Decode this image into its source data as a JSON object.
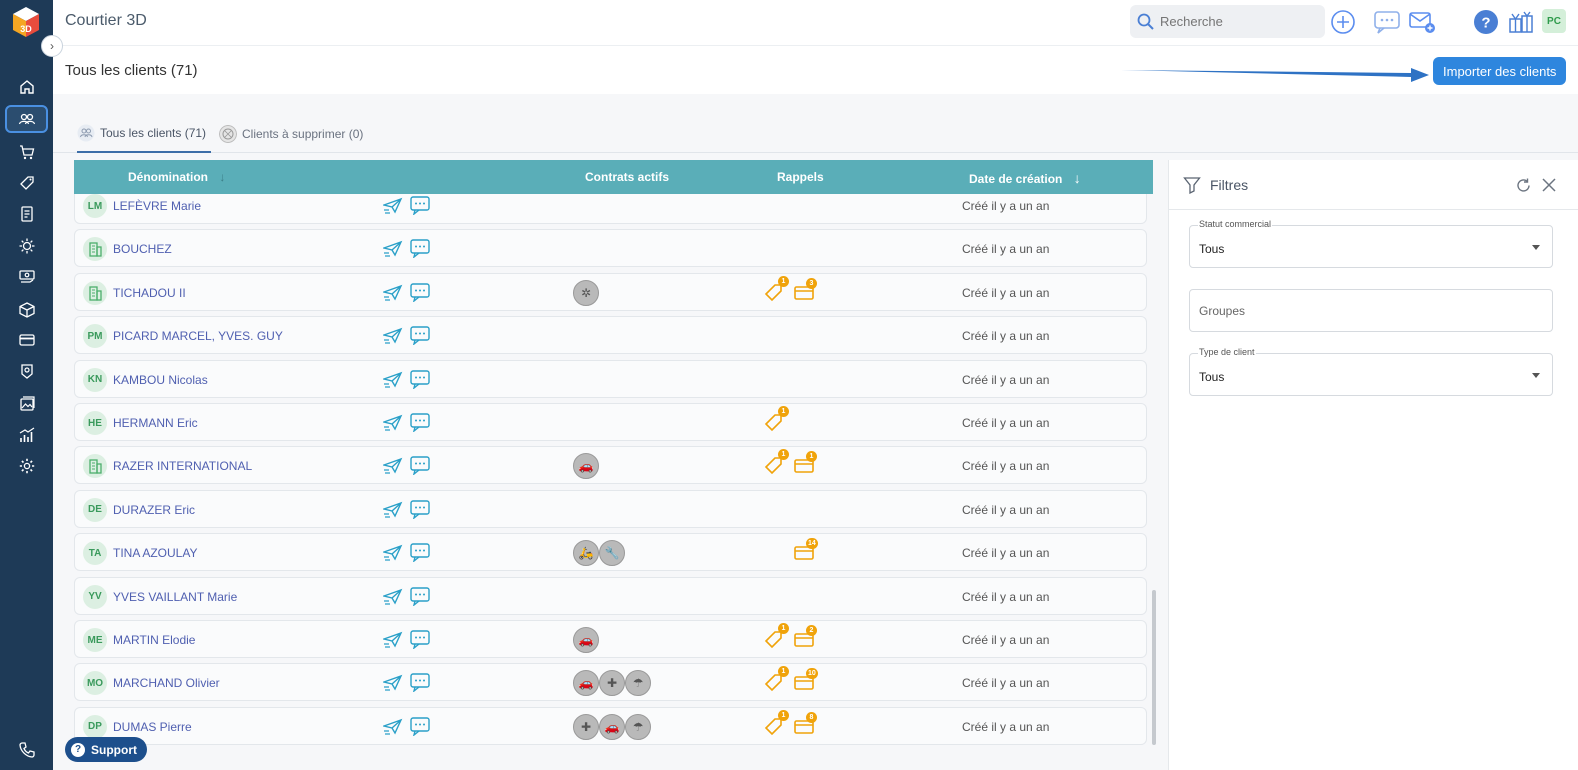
{
  "app": {
    "title": "Courtier 3D"
  },
  "search": {
    "placeholder": "Recherche"
  },
  "user": {
    "initials": "PC"
  },
  "page": {
    "title": "Tous les clients (71)",
    "import_label": "Importer des clients"
  },
  "tabs": [
    {
      "label": "Tous les clients (71)"
    },
    {
      "label": "Clients à supprimer (0)"
    }
  ],
  "table": {
    "headers": {
      "name": "Dénomination",
      "contracts": "Contrats actifs",
      "reminders": "Rappels",
      "created": "Date de création"
    }
  },
  "rows": [
    {
      "initials": "LM",
      "name": "LEFÈVRE Marie",
      "company": false,
      "contracts": [],
      "tags": null,
      "mails": null,
      "date": "Créé il y a un an"
    },
    {
      "initials": "",
      "name": "BOUCHEZ",
      "company": true,
      "contracts": [],
      "tags": null,
      "mails": null,
      "date": "Créé il y a un an"
    },
    {
      "initials": "",
      "name": "TICHADOU II",
      "company": true,
      "contracts": [
        "✲"
      ],
      "tags": "1",
      "mails": "3",
      "date": "Créé il y a un an"
    },
    {
      "initials": "PM",
      "name": "PICARD MARCEL, YVES. GUY",
      "company": false,
      "contracts": [],
      "tags": null,
      "mails": null,
      "date": "Créé il y a un an"
    },
    {
      "initials": "KN",
      "name": "KAMBOU Nicolas",
      "company": false,
      "contracts": [],
      "tags": null,
      "mails": null,
      "date": "Créé il y a un an"
    },
    {
      "initials": "HE",
      "name": "HERMANN Eric",
      "company": false,
      "contracts": [],
      "tags": "1",
      "mails": null,
      "date": "Créé il y a un an"
    },
    {
      "initials": "",
      "name": "RAZER INTERNATIONAL",
      "company": true,
      "contracts": [
        "🚗"
      ],
      "tags": "1",
      "mails": "1",
      "date": "Créé il y a un an"
    },
    {
      "initials": "DE",
      "name": "DURAZER Eric",
      "company": false,
      "contracts": [],
      "tags": null,
      "mails": null,
      "date": "Créé il y a un an"
    },
    {
      "initials": "TA",
      "name": "TINA AZOULAY",
      "company": false,
      "contracts": [
        "🛵",
        "🔧"
      ],
      "tags": null,
      "mails": "14",
      "date": "Créé il y a un an"
    },
    {
      "initials": "YV",
      "name": "YVES VAILLANT Marie",
      "company": false,
      "contracts": [],
      "tags": null,
      "mails": null,
      "date": "Créé il y a un an"
    },
    {
      "initials": "ME",
      "name": "MARTIN Elodie",
      "company": false,
      "contracts": [
        "🚗"
      ],
      "tags": "1",
      "mails": "2",
      "date": "Créé il y a un an"
    },
    {
      "initials": "MO",
      "name": "MARCHAND Olivier",
      "company": false,
      "contracts": [
        "🚗",
        "✚",
        "☂"
      ],
      "tags": "1",
      "mails": "10",
      "date": "Créé il y a un an"
    },
    {
      "initials": "DP",
      "name": "DUMAS Pierre",
      "company": false,
      "contracts": [
        "✚",
        "🚗",
        "☂"
      ],
      "tags": "1",
      "mails": "8",
      "date": "Créé il y a un an"
    }
  ],
  "filters": {
    "title": "Filtres",
    "statut": {
      "label": "Statut commercial",
      "value": "Tous"
    },
    "groupes": {
      "placeholder": "Groupes"
    },
    "type": {
      "label": "Type de client",
      "value": "Tous"
    }
  },
  "support": {
    "label": "Support"
  },
  "colors": {
    "sidebar": "#1e3a57",
    "header": "#5aaeb8",
    "accent": "#2e86de",
    "badge": "#f0a30a"
  }
}
